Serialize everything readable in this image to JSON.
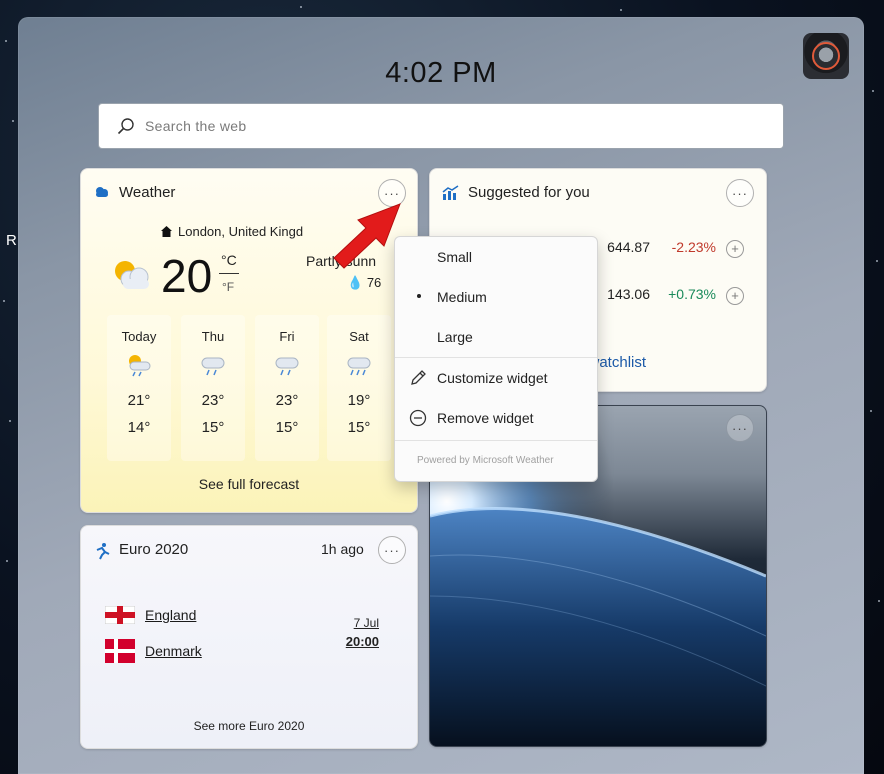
{
  "desktop": {
    "partial_char": "R"
  },
  "header": {
    "time": "4:02 PM",
    "avatar_icon": "user-avatar"
  },
  "search": {
    "placeholder": "Search the web"
  },
  "weather": {
    "title": "Weather",
    "location": "London, United Kingd",
    "temperature": "20",
    "unit_celsius": "°C",
    "unit_fahrenheit": "°F",
    "condition": "Partly sunn",
    "humidity": "76",
    "forecast": [
      {
        "day": "Today",
        "high": "21°",
        "low": "14°",
        "icon": "partly-sunny-rain-icon"
      },
      {
        "day": "Thu",
        "high": "23°",
        "low": "15°",
        "icon": "rain-cloud-icon"
      },
      {
        "day": "Fri",
        "high": "23°",
        "low": "15°",
        "icon": "rain-cloud-icon"
      },
      {
        "day": "Sat",
        "high": "19°",
        "low": "15°",
        "icon": "heavy-rain-icon"
      }
    ],
    "see_full_forecast": "See full forecast"
  },
  "stocks": {
    "title": "Suggested for you",
    "rows": [
      {
        "price": "644.87",
        "change": "-2.23%",
        "direction": "down"
      },
      {
        "price": "143.06",
        "change": "+0.73%",
        "direction": "up"
      }
    ],
    "watchlist_link": "o watchlist",
    "colors": {
      "down": "#c0392b",
      "up": "#1a8a5a"
    }
  },
  "context_menu": {
    "items": [
      {
        "label": "Small"
      },
      {
        "label": "Medium",
        "selected": true
      },
      {
        "label": "Large"
      },
      {
        "label": "Customize widget",
        "icon": "pencil-icon"
      },
      {
        "label": "Remove widget",
        "icon": "minus-circle-icon"
      }
    ],
    "footer": "Powered by Microsoft Weather"
  },
  "euro": {
    "title": "Euro 2020",
    "time_ago": "1h ago",
    "teams": [
      {
        "name": "England",
        "flag": "england-flag-icon"
      },
      {
        "name": "Denmark",
        "flag": "denmark-flag-icon"
      }
    ],
    "match_date": "7 Jul",
    "match_time": "20:00",
    "see_more": "See more Euro 2020"
  },
  "more_button": "···"
}
